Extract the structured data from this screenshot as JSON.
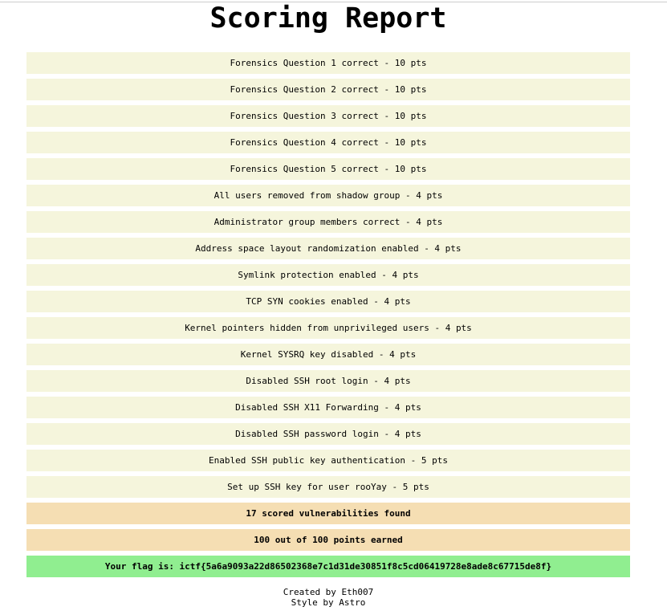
{
  "title": "Scoring Report",
  "items": [
    "Forensics Question 1 correct - 10 pts",
    "Forensics Question 2 correct - 10 pts",
    "Forensics Question 3 correct - 10 pts",
    "Forensics Question 4 correct - 10 pts",
    "Forensics Question 5 correct - 10 pts",
    "All users removed from shadow group - 4 pts",
    "Administrator group members correct - 4 pts",
    "Address space layout randomization enabled - 4 pts",
    "Symlink protection enabled - 4 pts",
    "TCP SYN cookies enabled - 4 pts",
    "Kernel pointers hidden from unprivileged users - 4 pts",
    "Kernel SYSRQ key disabled - 4 pts",
    "Disabled SSH root login - 4 pts",
    "Disabled SSH X11 Forwarding - 4 pts",
    "Disabled SSH password login - 4 pts",
    "Enabled SSH public key authentication - 5 pts",
    "Set up SSH key for user rooYay - 5 pts"
  ],
  "summary": {
    "vulns_found": "17 scored vulnerabilities found",
    "points_earned": "100 out of 100 points earned"
  },
  "flag": "Your flag is: ictf{5a6a9093a22d86502368e7c1d31de30851f8c5cd06419728e8ade8c67715de8f}",
  "footer": {
    "created_by": "Created by Eth007",
    "style_by": "Style by Astro"
  },
  "colors": {
    "item_bg": "#f5f5dc",
    "summary_bg": "#f5deb3",
    "flag_bg": "#90ee90"
  }
}
